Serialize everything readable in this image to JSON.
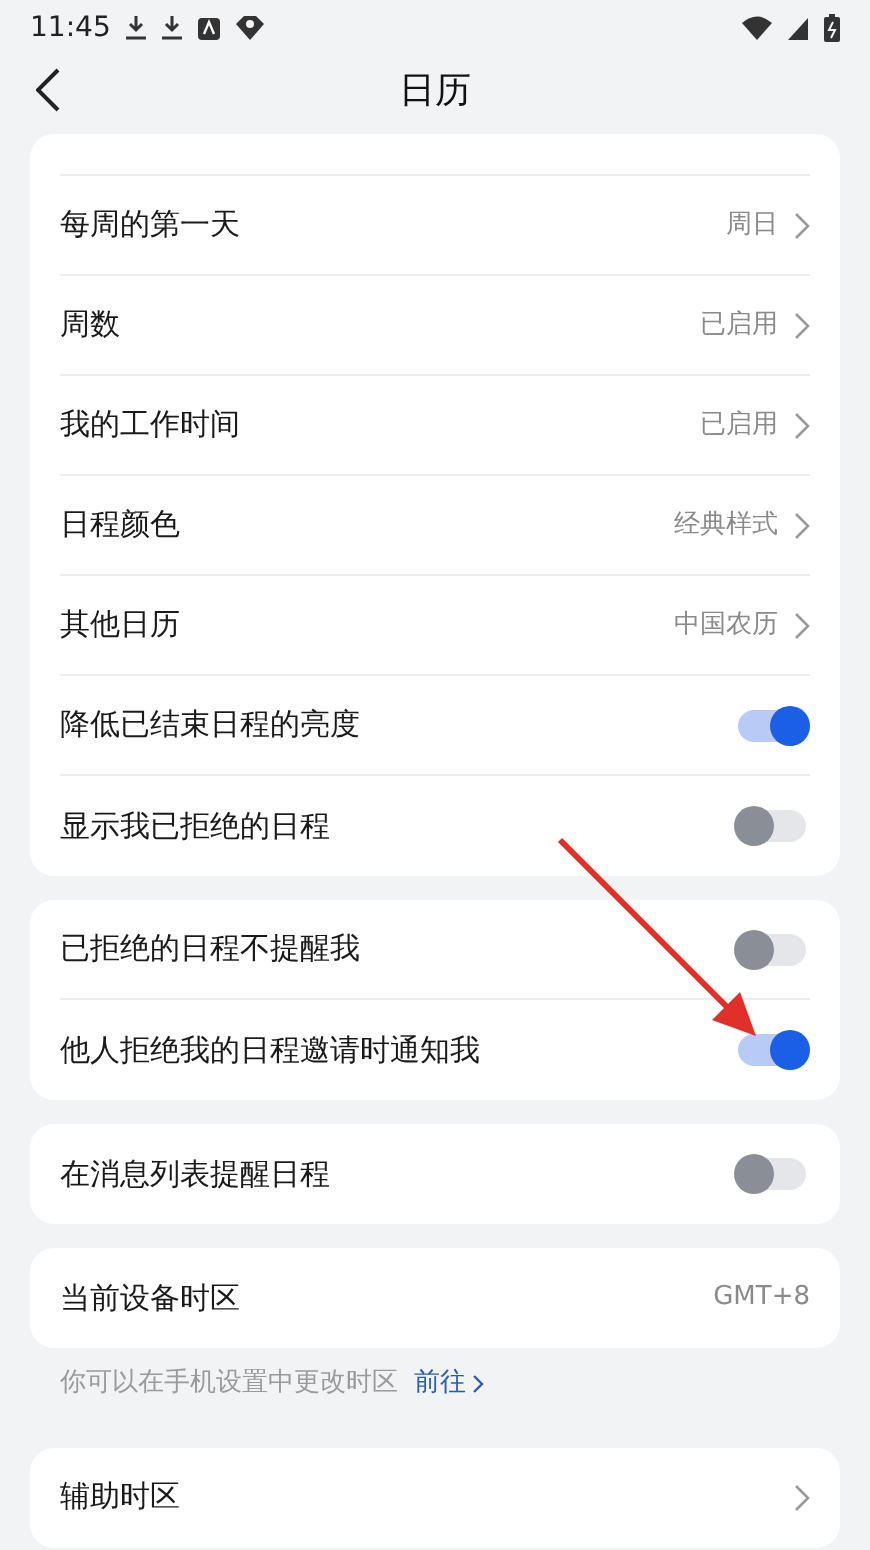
{
  "status_bar": {
    "time": "11:45"
  },
  "header": {
    "title": "日历"
  },
  "groups": [
    {
      "rows": [
        {
          "kind": "link",
          "label": "每周的第一天",
          "value": "周日"
        },
        {
          "kind": "link",
          "label": "周数",
          "value": "已启用"
        },
        {
          "kind": "link",
          "label": "我的工作时间",
          "value": "已启用"
        },
        {
          "kind": "link",
          "label": "日程颜色",
          "value": "经典样式"
        },
        {
          "kind": "link",
          "label": "其他日历",
          "value": "中国农历"
        },
        {
          "kind": "toggle",
          "label": "降低已结束日程的亮度",
          "on": true
        },
        {
          "kind": "toggle",
          "label": "显示我已拒绝的日程",
          "on": false
        }
      ]
    },
    {
      "rows": [
        {
          "kind": "toggle",
          "label": "已拒绝的日程不提醒我",
          "on": false
        },
        {
          "kind": "toggle",
          "label": "他人拒绝我的日程邀请时通知我",
          "on": true
        }
      ]
    },
    {
      "rows": [
        {
          "kind": "toggle",
          "label": "在消息列表提醒日程",
          "on": false
        }
      ]
    },
    {
      "rows": [
        {
          "kind": "text",
          "label": "当前设备时区",
          "value": "GMT+8"
        }
      ],
      "hint": {
        "text": "你可以在手机设置中更改时区",
        "link": "前往"
      }
    },
    {
      "rows": [
        {
          "kind": "link",
          "label": "辅助时区"
        }
      ]
    }
  ]
}
